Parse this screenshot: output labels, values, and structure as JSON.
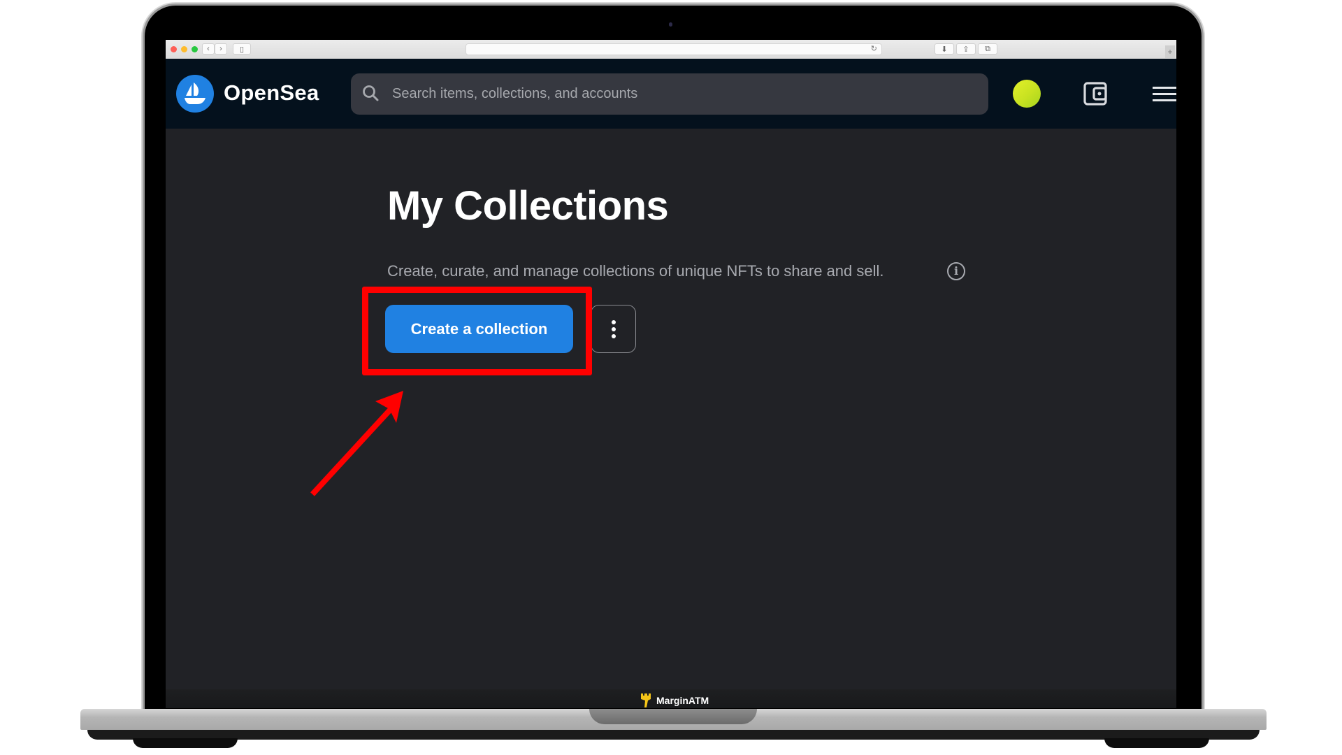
{
  "browser": {
    "url": "",
    "icons": [
      "back-icon",
      "forward-icon",
      "sidebar-icon",
      "reload-icon",
      "download-icon",
      "share-icon",
      "tabs-icon",
      "new-tab-icon"
    ]
  },
  "nav": {
    "brand": "OpenSea",
    "search_placeholder": "Search items, collections, and accounts"
  },
  "main": {
    "title": "My Collections",
    "subtitle": "Create, curate, and manage collections of unique NFTs to share and sell.",
    "info_glyph": "i",
    "create_button_label": "Create a collection"
  },
  "overlay": {
    "highlight_color": "#ff0000",
    "annotation": "arrow pointing to Create a collection button"
  },
  "watermark": {
    "label": "MarginATM"
  },
  "colors": {
    "accent": "#2081e2",
    "nav_bg": "#04111d",
    "page_bg": "#212226"
  }
}
